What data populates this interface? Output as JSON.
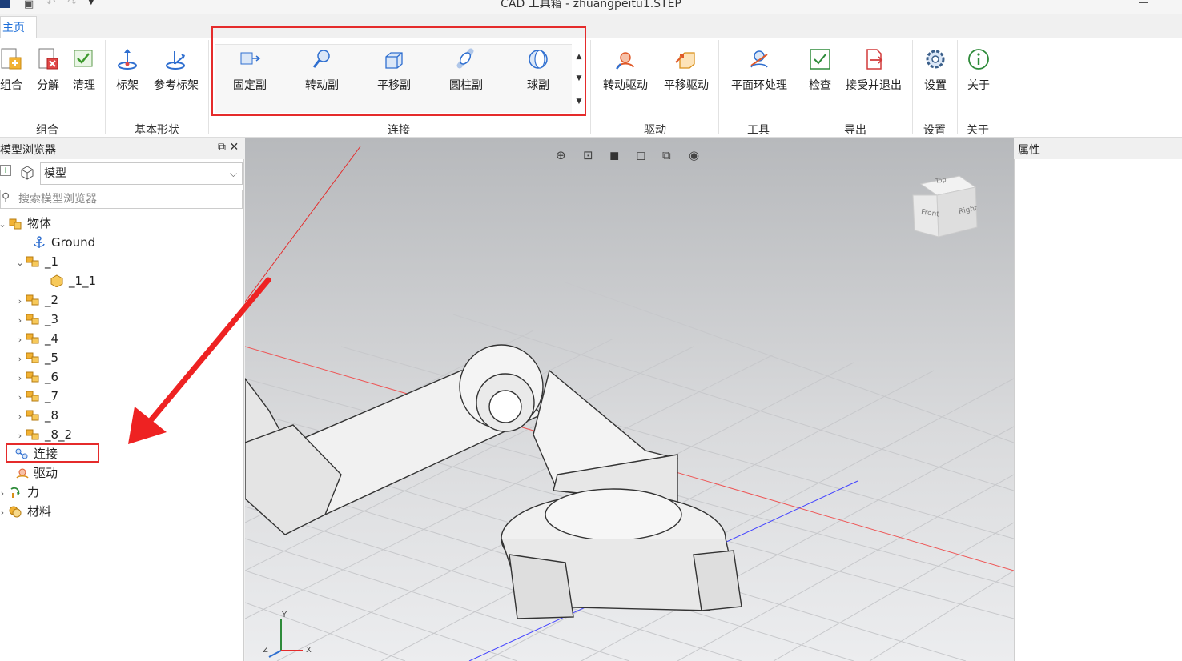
{
  "window": {
    "title": "CAD 工具箱 - zhuangpeitu1.STEP"
  },
  "tabs": [
    {
      "label": "主页"
    }
  ],
  "ribbon": {
    "groups": {
      "combine": {
        "label": "组合",
        "buttons": [
          "组合",
          "分解",
          "清理"
        ]
      },
      "basic_shapes": {
        "label": "基本形状",
        "buttons": [
          "标架",
          "参考标架"
        ]
      },
      "connect": {
        "label": "连接",
        "buttons": [
          "固定副",
          "转动副",
          "平移副",
          "圆柱副",
          "球副"
        ]
      },
      "drive": {
        "label": "驱动",
        "buttons": [
          "转动驱动",
          "平移驱动"
        ]
      },
      "tools": {
        "label": "工具",
        "buttons": [
          "平面环处理"
        ]
      },
      "export": {
        "label": "导出",
        "buttons": [
          "检查",
          "接受并退出"
        ]
      },
      "settings": {
        "label": "设置",
        "buttons": [
          "设置"
        ]
      },
      "about": {
        "label": "关于",
        "buttons": [
          "关于"
        ]
      }
    }
  },
  "model_browser": {
    "title": "模型浏览器",
    "selector_value": "模型",
    "search_placeholder": "搜索模型浏览器",
    "tree": {
      "bodies": "物体",
      "ground": "Ground",
      "items": [
        "_1",
        "_1_1",
        "_2",
        "_3",
        "_4",
        "_5",
        "_6",
        "_7",
        "_8",
        "_8_2"
      ],
      "connections": "连接",
      "drives": "驱动",
      "forces": "力",
      "materials": "材料"
    }
  },
  "properties": {
    "title": "属性"
  },
  "viewcube": {
    "front": "Front",
    "right": "Right",
    "top": "Top"
  },
  "axes": {
    "x": "X",
    "y": "Y",
    "z": "Z"
  },
  "colors": {
    "accent": "#1e6fd9",
    "highlight": "#e52b2b",
    "icon_blue": "#2f6fd0"
  }
}
